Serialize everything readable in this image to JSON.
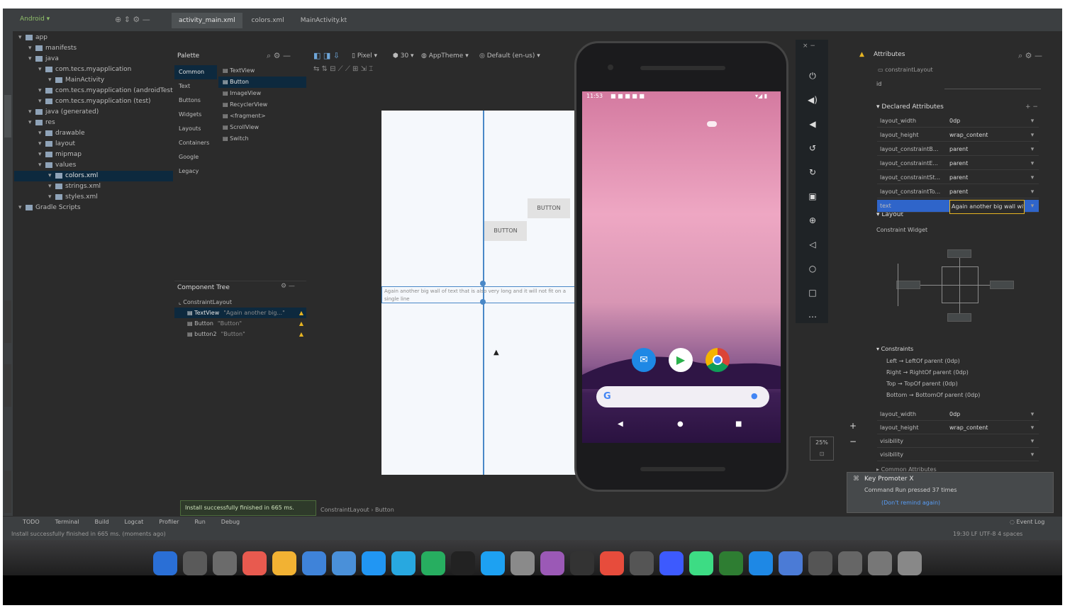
{
  "ide": {
    "project_dropdown": "Android",
    "file_tabs": [
      {
        "label": "activity_main.xml",
        "active": true
      },
      {
        "label": "colors.xml",
        "active": false
      },
      {
        "label": "MainActivity.kt",
        "active": false
      }
    ],
    "project_tree": [
      {
        "label": "app",
        "depth": 0
      },
      {
        "label": "manifests",
        "depth": 1
      },
      {
        "label": "java",
        "depth": 1
      },
      {
        "label": "com.tecs.myapplication",
        "depth": 2
      },
      {
        "label": "MainActivity",
        "depth": 3
      },
      {
        "label": "com.tecs.myapplication (androidTest)",
        "depth": 2
      },
      {
        "label": "com.tecs.myapplication (test)",
        "depth": 2
      },
      {
        "label": "java (generated)",
        "depth": 1
      },
      {
        "label": "res",
        "depth": 1
      },
      {
        "label": "drawable",
        "depth": 2
      },
      {
        "label": "layout",
        "depth": 2
      },
      {
        "label": "mipmap",
        "depth": 2
      },
      {
        "label": "values",
        "depth": 2
      },
      {
        "label": "colors.xml",
        "depth": 3,
        "selected": true
      },
      {
        "label": "strings.xml",
        "depth": 3
      },
      {
        "label": "styles.xml",
        "depth": 3
      },
      {
        "label": "Gradle Scripts",
        "depth": 0
      }
    ],
    "palette": {
      "header": "Palette",
      "categories": [
        "Common",
        "Text",
        "Buttons",
        "Widgets",
        "Layouts",
        "Containers",
        "Google",
        "Legacy"
      ],
      "items": [
        "TextView",
        "Button",
        "ImageView",
        "RecyclerView",
        "<fragment>",
        "ScrollView",
        "Switch"
      ]
    },
    "component_tree": {
      "header": "Component Tree",
      "items": [
        {
          "label": "ConstraintLayout",
          "detail": ""
        },
        {
          "label": "TextView",
          "detail": "\"Again another big...\""
        },
        {
          "label": "Button",
          "detail": "\"Button\""
        },
        {
          "label": "button2",
          "detail": "\"Button\""
        }
      ]
    },
    "design_toolbar": {
      "items": [
        "Pixel",
        "30",
        "AppTheme",
        "Default (en-us)"
      ]
    },
    "canvas": {
      "button1_label": "BUTTON",
      "button2_label": "BUTTON",
      "textview_text": "Again another big wall of text that is also very long and it will not fit on a single line"
    },
    "attributes": {
      "header": "Attributes",
      "id_label": "id",
      "id_value": "constraintLayout",
      "declared_header": "Declared Attributes",
      "declared_rows": [
        {
          "key": "layout_width",
          "value": "0dp"
        },
        {
          "key": "layout_height",
          "value": "wrap_content"
        },
        {
          "key": "layout_constraintB...",
          "value": "parent"
        },
        {
          "key": "layout_constraintE...",
          "value": "parent"
        },
        {
          "key": "layout_constraintSt...",
          "value": "parent"
        },
        {
          "key": "layout_constraintTo...",
          "value": "parent"
        },
        {
          "key": "text",
          "value": "Again another big wall with an"
        }
      ],
      "layout_header": "Layout",
      "constraint_widget": "Constraint Widget",
      "constraints_header": "Constraints",
      "constraints": [
        "Left → LeftOf parent (0dp)",
        "Right → RightOf parent (0dp)",
        "Top → TopOf parent (0dp)",
        "Bottom → BottomOf parent (0dp)"
      ],
      "bottom_rows": [
        {
          "key": "layout_width",
          "value": "0dp"
        },
        {
          "key": "layout_height",
          "value": "wrap_content"
        },
        {
          "key": "visibility",
          "value": ""
        },
        {
          "key": "visibility",
          "value": ""
        }
      ],
      "common_header": "Common Attributes"
    },
    "notification": {
      "title": "Key Promoter X",
      "body": "Command Run pressed 37 times",
      "link": "(Don't remind again)"
    },
    "zoom_label": "25%",
    "build_toast": "Install successfully finished in 665 ms.",
    "breadcrumb": [
      "ConstraintLayout",
      "Button"
    ],
    "bottom_tools": [
      "TODO",
      "Terminal",
      "Build",
      "Logcat",
      "Profiler",
      "Run",
      "Debug"
    ],
    "event_log": "Event Log",
    "status_message": "Install successfully finished in 665 ms. (moments ago)",
    "status_right": "19:30  LF  UTF-8  4 spaces"
  },
  "phone": {
    "status_time": "11:53",
    "nav": {
      "back": "◀",
      "home": "●",
      "recents": "■"
    },
    "dock_apps": [
      "messages-app",
      "play-store-app",
      "chrome-app"
    ],
    "search_placeholder": ""
  },
  "emulator_controls": [
    "power",
    "volume-up",
    "volume-down",
    "rotate-left",
    "rotate-right",
    "screenshot",
    "zoom",
    "back",
    "home",
    "overview",
    "more"
  ],
  "colors": {
    "ide_bg": "#2b2b2b",
    "panel_bg": "#3c3f41",
    "selection": "#0d293e",
    "accent": "#4a88c7",
    "wallpaper_top": "#e8a4c0",
    "wallpaper_bottom": "#3a1c4d"
  }
}
